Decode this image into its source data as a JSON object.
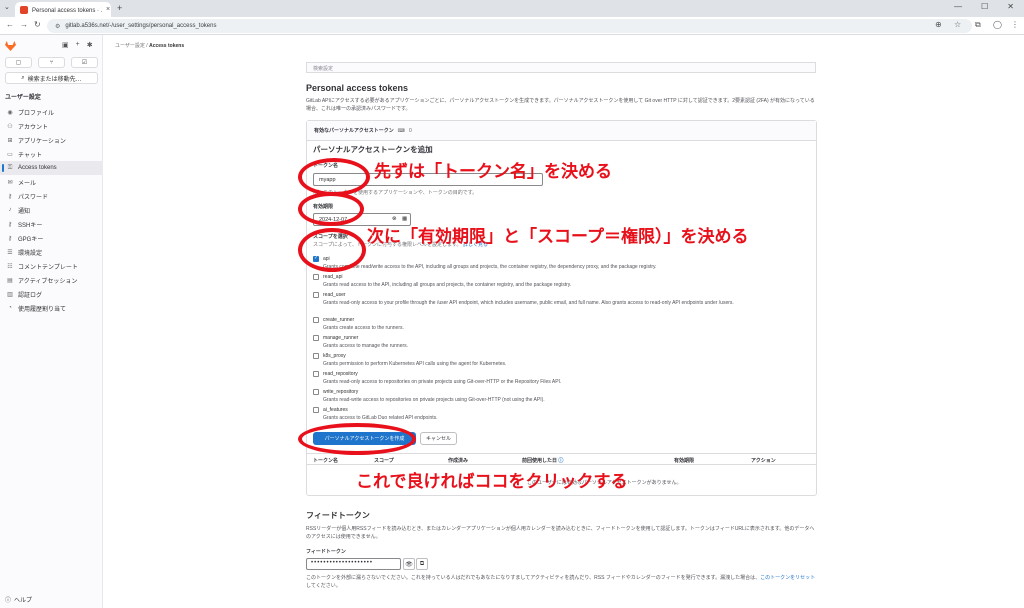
{
  "browser": {
    "tab_title": "Personal access tokens · ユーザ…",
    "url": "gitlab.a536s.net/-/user_settings/personal_access_tokens"
  },
  "sidebar": {
    "search_label": "検索または移動先…",
    "section_title": "ユーザー設定",
    "items": [
      {
        "label": "プロファイル",
        "icon": "profile-icon"
      },
      {
        "label": "アカウント",
        "icon": "account-icon"
      },
      {
        "label": "アプリケーション",
        "icon": "applications-icon"
      },
      {
        "label": "チャット",
        "icon": "chat-icon"
      },
      {
        "label": "Access tokens",
        "icon": "token-icon"
      },
      {
        "label": "メール",
        "icon": "mail-icon"
      },
      {
        "label": "パスワード",
        "icon": "password-icon"
      },
      {
        "label": "通知",
        "icon": "bell-icon"
      },
      {
        "label": "SSHキー",
        "icon": "key-icon"
      },
      {
        "label": "GPGキー",
        "icon": "gpg-key-icon"
      },
      {
        "label": "環境設定",
        "icon": "preferences-icon"
      },
      {
        "label": "コメントテンプレート",
        "icon": "comment-template-icon"
      },
      {
        "label": "アクティブセッション",
        "icon": "sessions-icon"
      },
      {
        "label": "認証ログ",
        "icon": "log-icon"
      },
      {
        "label": "使用履歴割り当て",
        "icon": "usage-icon"
      }
    ],
    "help_label": "ヘルプ"
  },
  "breadcrumb": {
    "parent": "ユーザー設定",
    "current": "Access tokens"
  },
  "main": {
    "search_placeholder": "検索設定",
    "title": "Personal access tokens",
    "description": "GitLab APIにアクセスする必要があるアプリケーションごとに、パーソナルアクセストークンを生成できます。パーソナルアクセストークンを使用して Git over HTTP に対して認証できます。2要素認証 (2FA) が有効になっている場合、これは唯一の承認済みパスワードです。",
    "card_header": "有効なパーソナルアクセストークン",
    "card_count": "0",
    "form_title": "パーソナルアクセストークンを追加",
    "token_name_label": "トークン名",
    "token_name_value": "myapp",
    "token_name_help": "例）このトークンを使用するアプリケーションや、トークンの目的です。",
    "expires_label": "有効期限",
    "expires_value": "2024-12-07",
    "scopes_label": "スコープを選択",
    "scopes_help": "スコープによって、トークンに付与する権限レベルを設定します。",
    "scopes_link": "詳しく見る",
    "scopes": [
      {
        "name": "api",
        "checked": true,
        "desc": "Grants complete read/write access to the API, including all groups and projects, the container registry, the dependency proxy, and the package registry."
      },
      {
        "name": "read_api",
        "checked": false,
        "desc": "Grants read access to the API, including all groups and projects, the container registry, and the package registry."
      },
      {
        "name": "read_user",
        "checked": false,
        "desc": "Grants read-only access to your profile through the /user API endpoint, which includes username, public email, and full name. Also grants access to read-only API endpoints under /users."
      },
      {
        "name": "create_runner",
        "checked": false,
        "desc": "Grants create access to the runners."
      },
      {
        "name": "manage_runner",
        "checked": false,
        "desc": "Grants access to manage the runners."
      },
      {
        "name": "k8s_proxy",
        "checked": false,
        "desc": "Grants permission to perform Kubernetes API calls using the agent for Kubernetes."
      },
      {
        "name": "read_repository",
        "checked": false,
        "desc": "Grants read-only access to repositories on private projects using Git-over-HTTP or the Repository Files API."
      },
      {
        "name": "write_repository",
        "checked": false,
        "desc": "Grants read-write access to repositories on private projects using Git-over-HTTP (not using the API)."
      },
      {
        "name": "ai_features",
        "checked": false,
        "desc": "Grants access to GitLab Duo related API endpoints."
      }
    ],
    "create_button": "パーソナルアクセストークンを作成",
    "cancel_button": "キャンセル",
    "table_headers": [
      "トークン名",
      "スコープ",
      "作成済み",
      "前回使用した日",
      "有効期限",
      "アクション"
    ],
    "empty_text": "このユーザーには有効なパーソナルアクセストークンがありません。"
  },
  "feed": {
    "title": "フィードトークン",
    "description": "RSSリーダーが個人用RSSフィードを読み込むとき、またはカレンダーアプリケーションが個人用カレンダーを読み込むときに、フィードトークンを使用して認証します。トークンはフィードURLに表示されます。他のデータへのアクセスには使用できません。",
    "label": "フィードトークン",
    "masked": "••••••••••••••••••••",
    "help": "このトークンを外部に漏らさないでください。これを持っている人はだれでもあなたになりすましてアクティビティを読んだり、RSS フィードやカレンダーのフィードを発行できます。漏洩した場合は、",
    "reset_link": "このトークンをリセット",
    "help_tail": "してください。"
  },
  "annotations": {
    "a1": "先ずは「トークン名」を決める",
    "a2": "次に「有効期限」と「スコープ＝権限）」を決める",
    "a3": "これで良ければココをクリックする",
    "color": "#e8101a"
  }
}
